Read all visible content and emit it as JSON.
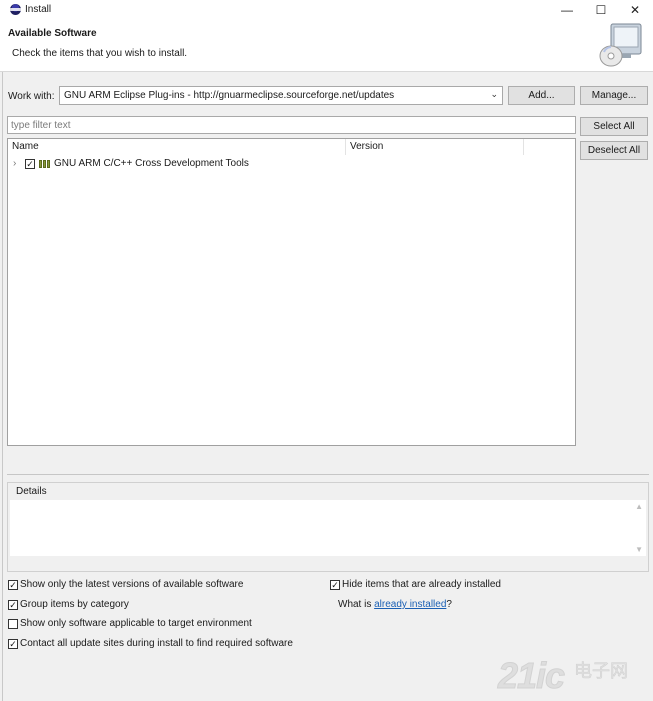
{
  "window": {
    "title": "Install",
    "controls": [
      "—",
      "☐",
      "✕"
    ]
  },
  "banner": {
    "title": "Available Software",
    "subtitle": "Check the items that you wish to install."
  },
  "work_with": {
    "label": "Work with:",
    "value": "GNU ARM Eclipse Plug-ins - http://gnuarmeclipse.sourceforge.net/updates",
    "add_label": "Add...",
    "manage_label": "Manage..."
  },
  "filter": {
    "placeholder": "type filter text"
  },
  "selection_buttons": {
    "select_all": "Select All",
    "deselect_all": "Deselect All"
  },
  "tree": {
    "columns": [
      "Name",
      "Version"
    ],
    "rows": [
      {
        "name": "GNU ARM C/C++ Cross Development Tools",
        "version": "",
        "checked": true,
        "expandable": true
      }
    ]
  },
  "details": {
    "label": "Details"
  },
  "options": {
    "latest_versions": {
      "label": "Show only the latest versions of available software",
      "checked": true
    },
    "group_by_category": {
      "label": "Group items by category",
      "checked": true
    },
    "target_env": {
      "label": "Show only software applicable to target environment",
      "checked": false
    },
    "contact_sites": {
      "label": "Contact all update sites during install to find required software",
      "checked": true
    },
    "hide_installed": {
      "label": "Hide items that are already installed",
      "checked": true
    },
    "what_is_prefix": "What is ",
    "what_is_link": "already installed",
    "what_is_suffix": "?"
  },
  "watermark": {
    "brand": "21ic",
    "cn": "电子网"
  },
  "colors": {
    "link": "#1a5fb4",
    "tree_icon": "#8a9a3c"
  }
}
